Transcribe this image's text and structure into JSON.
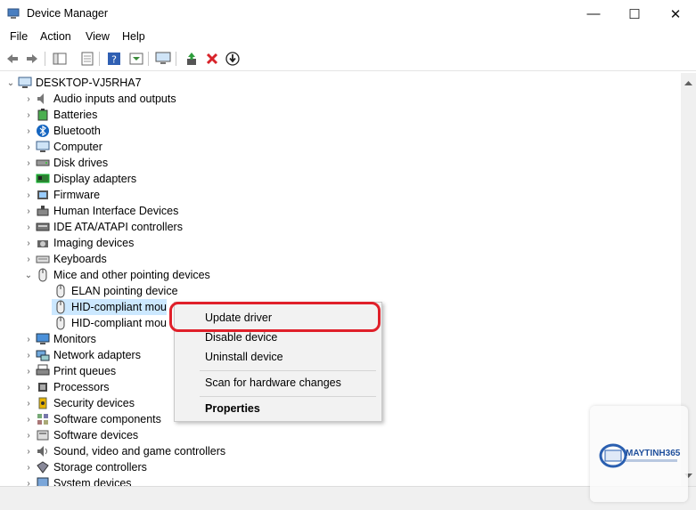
{
  "window": {
    "title": "Device Manager",
    "controls": {
      "minimize": "—",
      "maximize": "☐",
      "close": "✕"
    }
  },
  "menu": [
    "File",
    "Action",
    "View",
    "Help"
  ],
  "tree": {
    "root": "DESKTOP-VJ5RHA7",
    "categories": [
      {
        "label": "Audio inputs and outputs",
        "icon": "speaker-icon"
      },
      {
        "label": "Batteries",
        "icon": "battery-icon"
      },
      {
        "label": "Bluetooth",
        "icon": "bluetooth-icon"
      },
      {
        "label": "Computer",
        "icon": "computer-icon"
      },
      {
        "label": "Disk drives",
        "icon": "disk-drive-icon"
      },
      {
        "label": "Display adapters",
        "icon": "display-adapter-icon"
      },
      {
        "label": "Firmware",
        "icon": "firmware-icon"
      },
      {
        "label": "Human Interface Devices",
        "icon": "hid-icon"
      },
      {
        "label": "IDE ATA/ATAPI controllers",
        "icon": "ide-controller-icon"
      },
      {
        "label": "Imaging devices",
        "icon": "camera-icon"
      },
      {
        "label": "Keyboards",
        "icon": "keyboard-icon"
      },
      {
        "label": "Mice and other pointing devices",
        "icon": "mouse-icon",
        "expanded": true
      },
      {
        "label": "Monitors",
        "icon": "monitor-icon"
      },
      {
        "label": "Network adapters",
        "icon": "network-icon"
      },
      {
        "label": "Print queues",
        "icon": "printer-icon"
      },
      {
        "label": "Processors",
        "icon": "processor-icon"
      },
      {
        "label": "Security devices",
        "icon": "security-icon"
      },
      {
        "label": "Software components",
        "icon": "software-component-icon"
      },
      {
        "label": "Software devices",
        "icon": "software-device-icon"
      },
      {
        "label": "Sound, video and game controllers",
        "icon": "sound-icon"
      },
      {
        "label": "Storage controllers",
        "icon": "storage-icon"
      },
      {
        "label": "System devices",
        "icon": "system-icon"
      }
    ],
    "mice_children": [
      "ELAN pointing device",
      "HID-compliant mou",
      "HID-compliant mou"
    ]
  },
  "context_menu": {
    "update": "Update driver",
    "disable": "Disable device",
    "uninstall": "Uninstall device",
    "scan": "Scan for hardware changes",
    "properties": "Properties"
  },
  "watermark": {
    "brand": "MAYTINH365"
  },
  "colors": {
    "highlight": "#e0202a",
    "selection": "#cce8ff",
    "menu_bg": "#f2f2f2"
  }
}
